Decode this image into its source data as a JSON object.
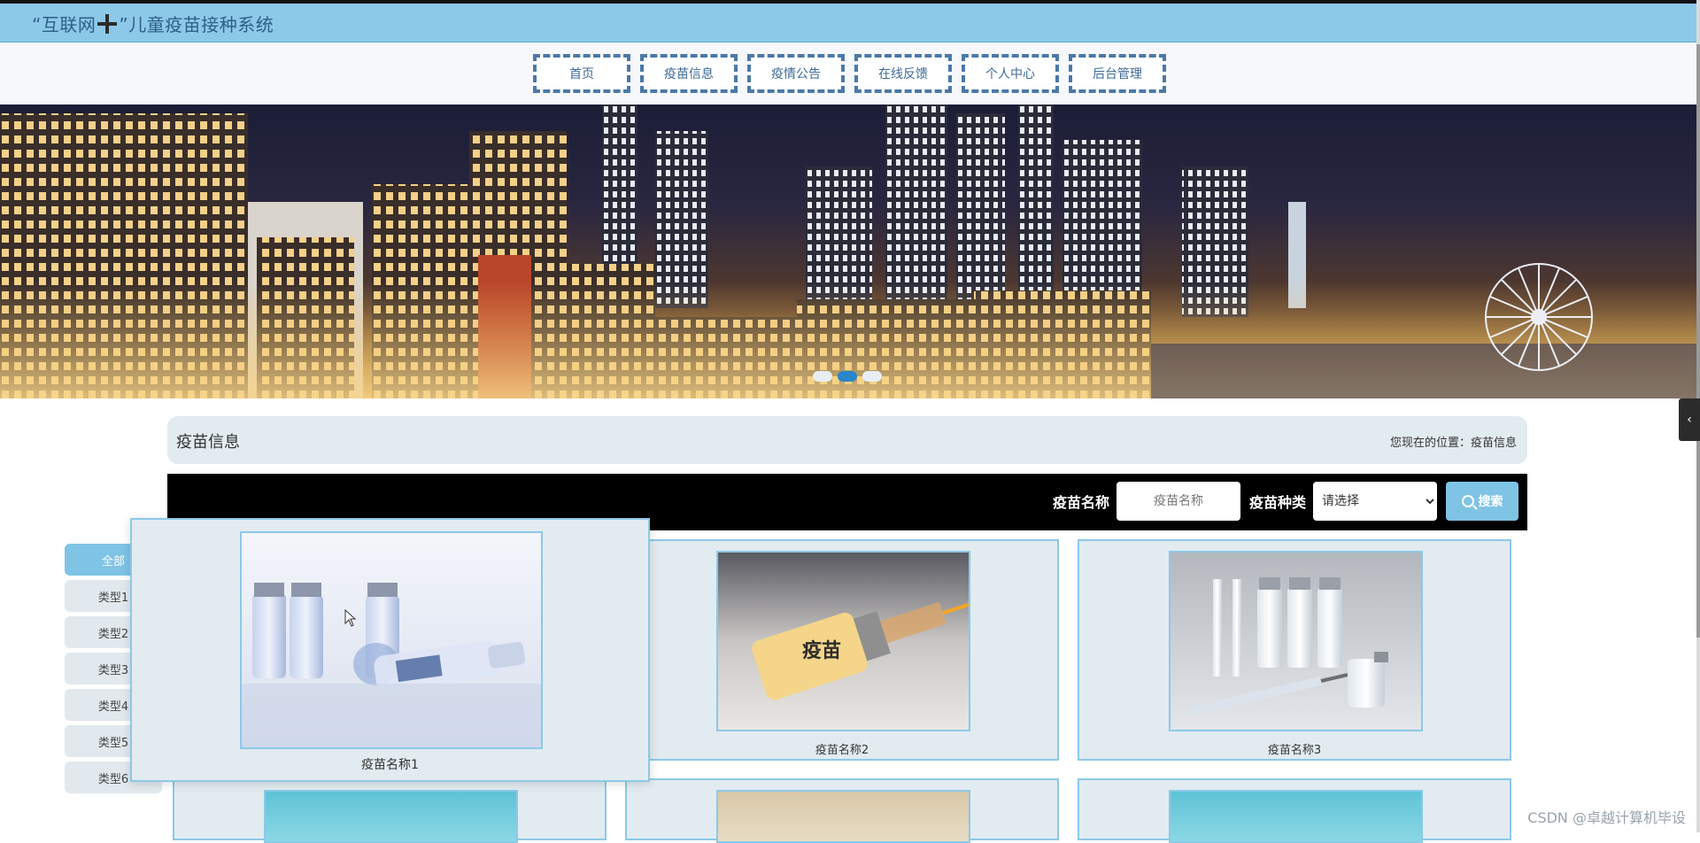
{
  "header": {
    "title_part1": "“互联网",
    "title_part2": "”儿童疫苗接种系统",
    "plus_icon": "cross-icon"
  },
  "nav": {
    "items": [
      {
        "label": "首页"
      },
      {
        "label": "疫苗信息"
      },
      {
        "label": "疫情公告"
      },
      {
        "label": "在线反馈"
      },
      {
        "label": "个人中心"
      },
      {
        "label": "后台管理"
      }
    ]
  },
  "banner": {
    "slides": 3,
    "active_slide": 2
  },
  "section": {
    "title": "疫苗信息",
    "breadcrumb": "您现在的位置：疫苗信息"
  },
  "search": {
    "name_label": "疫苗名称",
    "name_placeholder": "疫苗名称",
    "type_label": "疫苗种类",
    "type_selected": "请选择",
    "button_label": "搜索",
    "button_icon": "search-icon"
  },
  "categories": {
    "items": [
      {
        "label": "全部",
        "active": true
      },
      {
        "label": "类型1"
      },
      {
        "label": "类型2"
      },
      {
        "label": "类型3"
      },
      {
        "label": "类型4"
      },
      {
        "label": "类型5"
      },
      {
        "label": "类型6"
      }
    ]
  },
  "products": {
    "items": [
      {
        "name": "疫苗名称1"
      },
      {
        "name": "疫苗名称2",
        "vial_text": "疫苗"
      },
      {
        "name": "疫苗名称3"
      }
    ]
  },
  "watermark": "CSDN @卓越计算机毕设",
  "colors": {
    "header_bg": "#8cc9e8",
    "accent": "#7fc3e5",
    "nav_border": "#4b79a8",
    "panel_bg": "#e2ebf0",
    "search_bg": "#000000"
  }
}
